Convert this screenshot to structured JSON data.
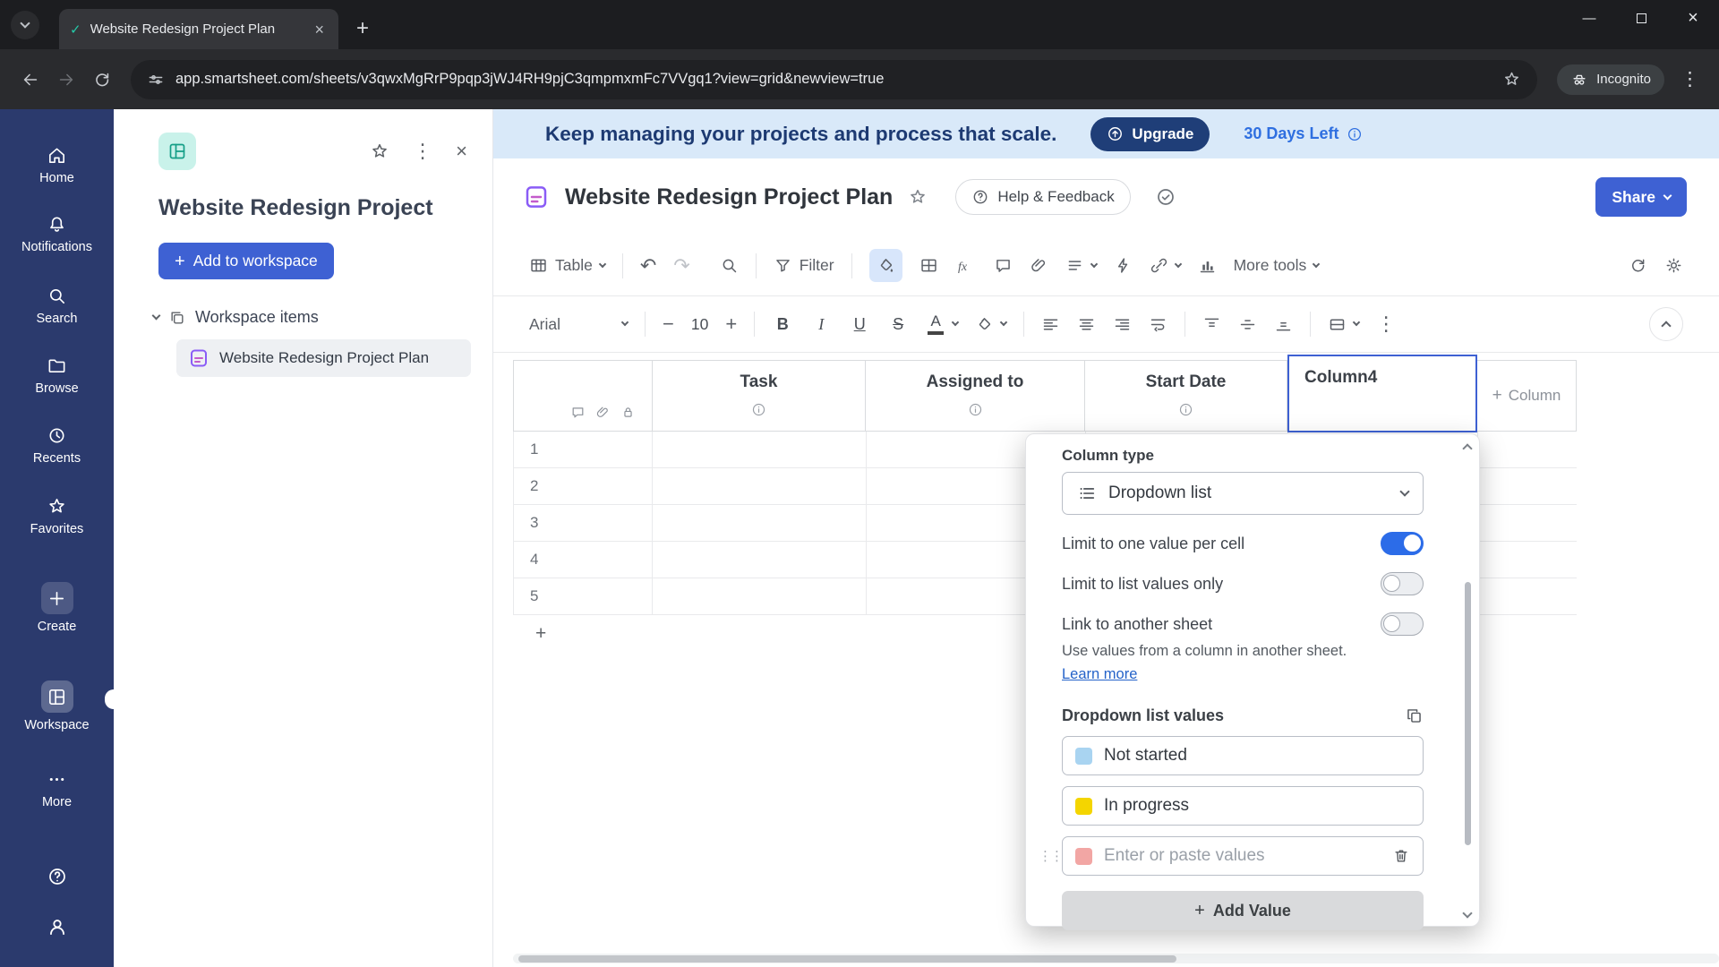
{
  "browser": {
    "tab_title": "Website Redesign Project Plan",
    "url": "app.smartsheet.com/sheets/v3qwxMgRrP9pqp3jWJ4RH9pjC3qmpmxmFc7VVgq1?view=grid&newview=true",
    "incognito_label": "Incognito"
  },
  "nav": {
    "items": [
      {
        "label": "Home"
      },
      {
        "label": "Notifications"
      },
      {
        "label": "Search"
      },
      {
        "label": "Browse"
      },
      {
        "label": "Recents"
      },
      {
        "label": "Favorites"
      },
      {
        "label": "Create"
      },
      {
        "label": "Workspace"
      },
      {
        "label": "More"
      }
    ]
  },
  "workspace_panel": {
    "title": "Website Redesign Project",
    "add_button_label": "Add to workspace",
    "section_label": "Workspace items",
    "item_label": "Website Redesign Project Plan"
  },
  "banner": {
    "message": "Keep managing your projects and process that scale.",
    "upgrade_label": "Upgrade",
    "days_left_label": "30 Days Left"
  },
  "sheet_header": {
    "title": "Website Redesign Project Plan",
    "help_label": "Help & Feedback",
    "share_label": "Share"
  },
  "toolbar": {
    "table_label": "Table",
    "filter_label": "Filter",
    "fx_label": "fx",
    "more_tools_label": "More tools"
  },
  "format_bar": {
    "font_name": "Arial",
    "font_size": "10"
  },
  "grid": {
    "columns": [
      "Task",
      "Assigned to",
      "Start Date",
      "Column4"
    ],
    "add_column_label": "Column",
    "row_numbers": [
      "1",
      "2",
      "3",
      "4",
      "5"
    ]
  },
  "column_settings": {
    "column_type_label": "Column type",
    "column_type_value": "Dropdown list",
    "toggles": [
      {
        "label": "Limit to one value per cell",
        "on": true
      },
      {
        "label": "Limit to list values only",
        "on": false
      },
      {
        "label": "Link to another sheet",
        "on": false
      }
    ],
    "link_hint": "Use values from a column in another sheet.",
    "learn_more_label": "Learn more",
    "values_label": "Dropdown list values",
    "values": [
      {
        "label": "Not started",
        "color": "#a9d4f1"
      },
      {
        "label": "In progress",
        "color": "#f4d500"
      }
    ],
    "new_value_placeholder": "Enter or paste values",
    "new_value_color": "#f2a6a4",
    "add_value_label": "Add Value"
  },
  "colors": {
    "accent_blue": "#3e61d3",
    "toggle_on_blue": "#2c6ce8",
    "banner_bg": "#d9e9f9",
    "nav_bg": "#2b3a6d"
  }
}
